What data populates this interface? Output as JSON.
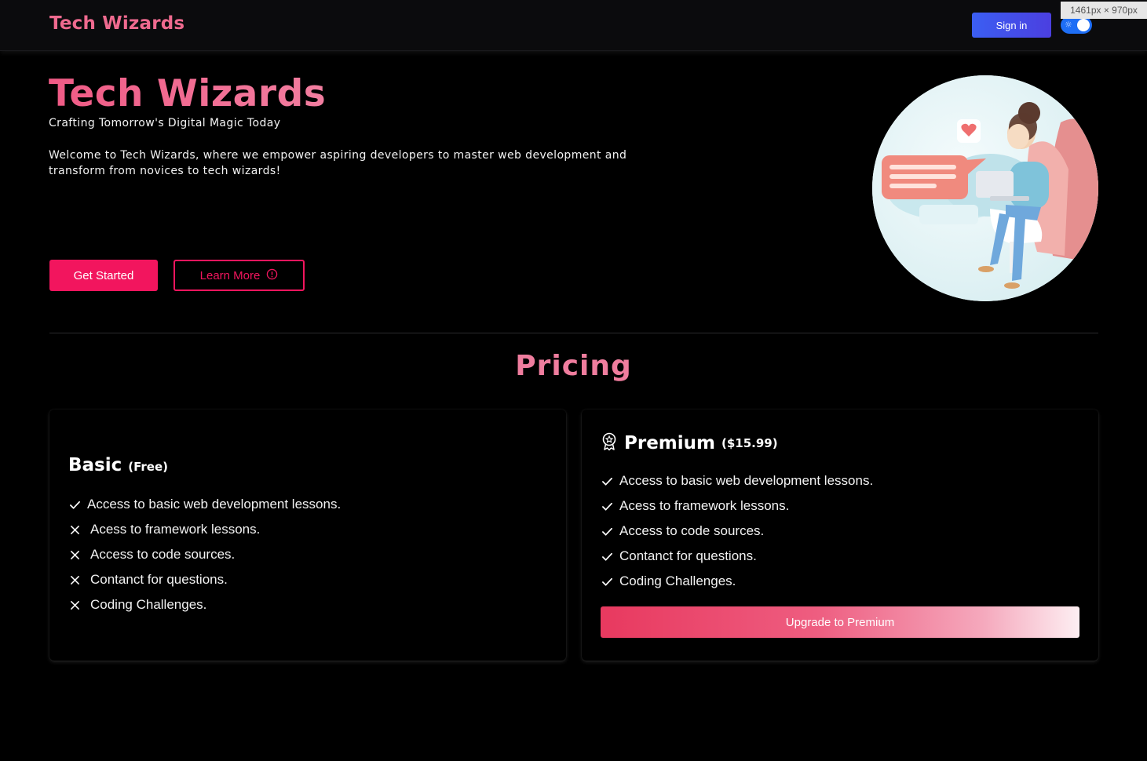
{
  "nav": {
    "brand": "Tech Wizards",
    "signin_label": "Sign in",
    "dimension_badge": "1461px × 970px"
  },
  "hero": {
    "title": "Tech Wizards",
    "subtitle": "Crafting Tomorrow's Digital Magic Today",
    "description": "Welcome to Tech Wizards, where we empower aspiring developers to master web development and transform from novices to tech wizards!",
    "primary_label": "Get Started",
    "secondary_label": "Learn More"
  },
  "pricing": {
    "title": "Pricing",
    "basic": {
      "name": "Basic",
      "price": "(Free)",
      "features": [
        {
          "text": "Access to basic web development lessons.",
          "included": true
        },
        {
          "text": "Acess to framework lessons.",
          "included": false
        },
        {
          "text": "Access to code sources.",
          "included": false
        },
        {
          "text": "Contanct for questions.",
          "included": false
        },
        {
          "text": "Coding Challenges.",
          "included": false
        }
      ]
    },
    "premium": {
      "name": "Premium",
      "price": "($15.99)",
      "features": [
        {
          "text": "Access to basic web development lessons.",
          "included": true
        },
        {
          "text": "Acess to framework lessons.",
          "included": true
        },
        {
          "text": "Access to code sources.",
          "included": true
        },
        {
          "text": "Contanct for questions.",
          "included": true
        },
        {
          "text": "Coding Challenges.",
          "included": true
        }
      ],
      "button_label": "Upgrade to Premium"
    }
  },
  "colors": {
    "accent": "#f2155e",
    "brand": "#ef6a8f",
    "signin": "#3b5ef2"
  }
}
